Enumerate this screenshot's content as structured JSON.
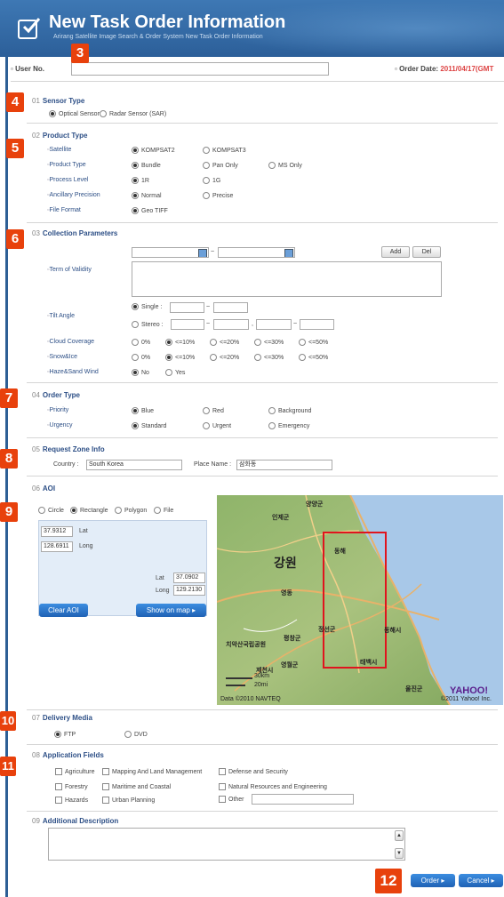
{
  "header": {
    "title": "New Task Order Information",
    "subtitle": "Arirang Satellite Image Search & Order System New Task Order Information"
  },
  "user": {
    "label": "User No.",
    "value": "",
    "order_date_label": "Order Date:",
    "order_date": "2011/04/17(GMT"
  },
  "badges": [
    "3",
    "4",
    "5",
    "6",
    "7",
    "8",
    "9",
    "10",
    "11",
    "12"
  ],
  "sensor": {
    "num": "01",
    "title": "Sensor Type",
    "options": [
      "Optical Sensor",
      "Radar Sensor (SAR)"
    ],
    "selected": 0
  },
  "product": {
    "num": "02",
    "title": "Product Type",
    "satellite": {
      "label": "Satellite",
      "options": [
        "KOMPSAT2",
        "KOMPSAT3"
      ]
    },
    "ptype": {
      "label": "Product Type",
      "options": [
        "Bundle",
        "Pan Only",
        "MS Only"
      ]
    },
    "level": {
      "label": "Process Level",
      "options": [
        "1R",
        "1G"
      ]
    },
    "ancillary": {
      "label": "Ancillary Precision",
      "options": [
        "Normal",
        "Precise"
      ]
    },
    "format": {
      "label": "File Format",
      "options": [
        "Geo TIFF"
      ]
    }
  },
  "collection": {
    "num": "03",
    "title": "Collection Parameters",
    "tilde": "~",
    "add": "Add",
    "del": "Del",
    "validity": "Term of Validity",
    "tilt": {
      "label": "Tilt Angle",
      "single": "Single :",
      "stereo": "Stereo :",
      "sep": ",",
      "t1": "~",
      "t2": "~",
      "t3": "~"
    },
    "cloud": {
      "label": "Cloud Coverage",
      "options": [
        "0%",
        "<=10%",
        "<=20%",
        "<=30%",
        "<=50%"
      ]
    },
    "snow": {
      "label": "Snow&Ice",
      "options": [
        "0%",
        "<=10%",
        "<=20%",
        "<=30%",
        "<=50%"
      ]
    },
    "haze": {
      "label": "Haze&Sand Wind",
      "options": [
        "No",
        "Yes"
      ]
    }
  },
  "order": {
    "num": "04",
    "title": "Order Type",
    "priority": {
      "label": "Priority",
      "options": [
        "Blue",
        "Red",
        "Background"
      ]
    },
    "urgency": {
      "label": "Urgency",
      "options": [
        "Standard",
        "Urgent",
        "Emergency"
      ]
    }
  },
  "zone": {
    "num": "05",
    "title": "Request Zone Info",
    "country_label": "Country :",
    "country": "South Korea",
    "place_label": "Place Name :",
    "place": "삼화동"
  },
  "aoi": {
    "num": "06",
    "title": "AOI",
    "options": [
      "Circle",
      "Rectangle",
      "Polygon",
      "File"
    ],
    "lat1": "37.9312",
    "lat_label": "Lat",
    "long1": "128.6911",
    "long_label": "Long",
    "lat2": "37.0902",
    "long2": "129.2130",
    "clear": "Clear AOI",
    "show": "Show on map ▸",
    "map_labels": {
      "gangwon": "강원",
      "inje": "인제군",
      "yangyang": "양양군",
      "donghae": "동해",
      "taebaek": "태백시",
      "samcheok": "동해시",
      "jecheon": "제천시",
      "yeongwol": "영월군",
      "pyeongchang": "평창군",
      "jeongseon": "정선군",
      "uljin": "울진군",
      "chiak": "치악산국립공원",
      "yeongdong": "영동",
      "copyright": "Data ©2010 NAVTEQ",
      "yahoo": "YAHOO!",
      "yahoo_copy": "©2011 Yahoo! Inc.",
      "scale1": "30km",
      "scale2": "20mi"
    }
  },
  "delivery": {
    "num": "07",
    "title": "Delivery Media",
    "options": [
      "FTP",
      "DVD"
    ]
  },
  "fields": {
    "num": "08",
    "title": "Application Fields",
    "items": [
      "Agriculture",
      "Mapping And Land Management",
      "Defense and Security",
      "Forestry",
      "Maritime and Coastal",
      "Natural Resources and Engineering",
      "Hazards",
      "Urban Planning",
      "Other"
    ]
  },
  "desc": {
    "num": "09",
    "title": "Additional Description"
  },
  "actions": {
    "order": "Order ▸",
    "cancel": "Cancel ▸"
  },
  "colors": {
    "header": "#2c5f99",
    "badge": "#e8410c",
    "section": "#2d4f86",
    "button": "#1f62b5"
  }
}
